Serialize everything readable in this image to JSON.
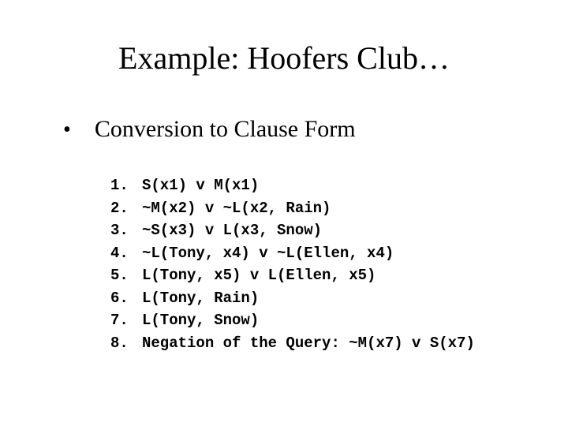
{
  "title": "Example: Hoofers Club…",
  "subtitle": "Conversion to Clause Form",
  "clauses": [
    {
      "num": "1.",
      "text": "S(x1) v M(x1)"
    },
    {
      "num": "2.",
      "text": "~M(x2) v ~L(x2, Rain)"
    },
    {
      "num": "3.",
      "text": "~S(x3) v L(x3, Snow)"
    },
    {
      "num": "4.",
      "text": "~L(Tony, x4) v ~L(Ellen, x4)"
    },
    {
      "num": "5.",
      "text": "L(Tony, x5) v L(Ellen, x5)"
    },
    {
      "num": "6.",
      "text": "L(Tony, Rain)"
    },
    {
      "num": "7.",
      "text": "L(Tony, Snow)"
    },
    {
      "num": "8.",
      "text": "Negation of the Query: ~M(x7) v S(x7)"
    }
  ]
}
